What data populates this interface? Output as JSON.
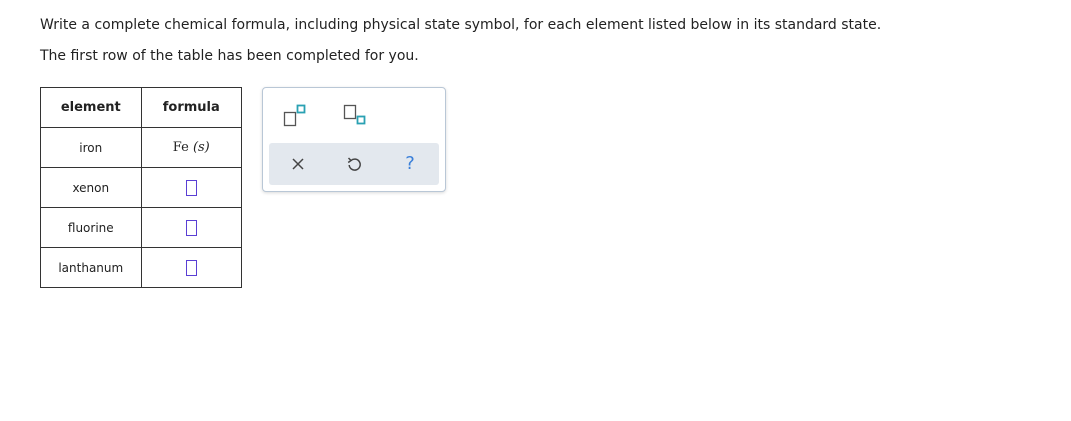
{
  "instructions": {
    "line1": "Write a complete chemical formula, including physical state symbol, for each element listed below in its standard state.",
    "line2": "The first row of the table has been completed for you."
  },
  "table": {
    "headers": {
      "element": "element",
      "formula": "formula"
    },
    "rows": [
      {
        "element": "iron",
        "formula_main": "Fe",
        "formula_state": "(s)"
      },
      {
        "element": "xenon"
      },
      {
        "element": "fluorine"
      },
      {
        "element": "lanthanum"
      }
    ]
  },
  "palette": {
    "icons": [
      "superscript-icon",
      "subscript-icon",
      "clear-icon",
      "undo-icon",
      "help-icon"
    ],
    "help_label": "?",
    "accent_color": "#2aa1b3",
    "help_color": "#3a7fd9"
  }
}
